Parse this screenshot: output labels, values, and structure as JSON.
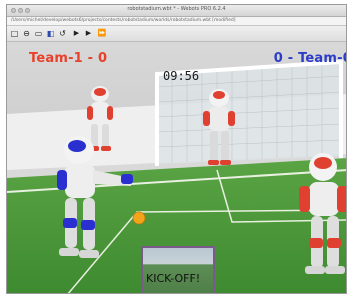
{
  "window": {
    "title": "robotstadium.wbt * - Webots PRO 6.2.4",
    "path": "/Users/michel/develop/webots6/projects/contests/robotstadium/worlds/robotstadium.wbt [modified]"
  },
  "toolbar": {
    "buttons": [
      {
        "name": "new-world-icon",
        "glyph": "□"
      },
      {
        "name": "open-icon",
        "glyph": "⊖"
      },
      {
        "name": "save-icon",
        "glyph": "▭"
      },
      {
        "name": "revert-icon",
        "glyph": "◧"
      },
      {
        "name": "reload-icon",
        "glyph": "↺"
      },
      {
        "name": "step-icon",
        "glyph": "▶"
      },
      {
        "name": "run-icon",
        "glyph": "▶"
      },
      {
        "name": "fast-forward-icon",
        "glyph": "⏩"
      }
    ]
  },
  "scoreboard": {
    "left": "Team-1 - 0",
    "right": "0 - Team-0",
    "left_color": "#e8402a",
    "right_color": "#2a3cc8",
    "clock": "09:56"
  },
  "inset": {
    "message": "KICK-OFF!"
  },
  "colors": {
    "field": "#4f9a3c",
    "wall": "#f2f2f2",
    "red_team": "#e04030",
    "blue_team": "#2a30d0",
    "ball": "#f2a51a"
  }
}
